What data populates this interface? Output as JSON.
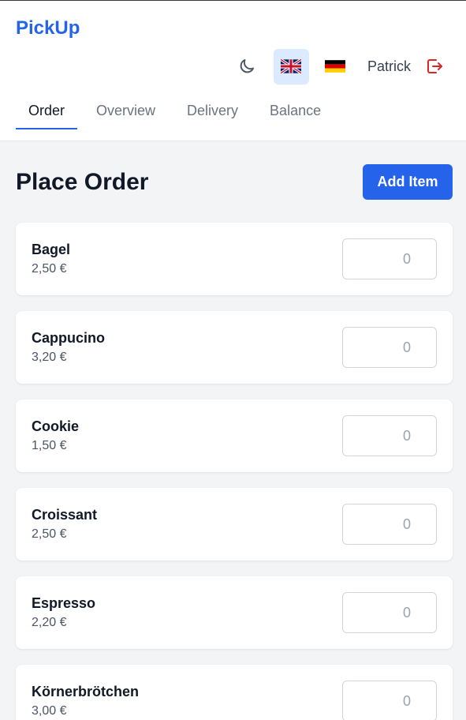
{
  "app": {
    "title": "PickUp"
  },
  "header": {
    "username": "Patrick",
    "icons": {
      "theme": "moon-icon",
      "lang_en": "uk-flag-icon",
      "lang_de": "germany-flag-icon",
      "logout": "logout-icon"
    }
  },
  "nav": {
    "tabs": [
      {
        "label": "Order",
        "active": true
      },
      {
        "label": "Overview",
        "active": false
      },
      {
        "label": "Delivery",
        "active": false
      },
      {
        "label": "Balance",
        "active": false
      }
    ]
  },
  "main": {
    "title": "Place Order",
    "add_button": "Add Item",
    "items": [
      {
        "name": "Bagel",
        "price": "2,50 €",
        "qty_placeholder": "0"
      },
      {
        "name": "Cappucino",
        "price": "3,20 €",
        "qty_placeholder": "0"
      },
      {
        "name": "Cookie",
        "price": "1,50 €",
        "qty_placeholder": "0"
      },
      {
        "name": "Croissant",
        "price": "2,50 €",
        "qty_placeholder": "0"
      },
      {
        "name": "Espresso",
        "price": "2,20 €",
        "qty_placeholder": "0"
      },
      {
        "name": "Körnerbrötchen",
        "price": "3,00 €",
        "qty_placeholder": "0"
      }
    ]
  },
  "colors": {
    "accent": "#2563eb",
    "logout": "#dc2626",
    "background": "#f3f4f6"
  }
}
